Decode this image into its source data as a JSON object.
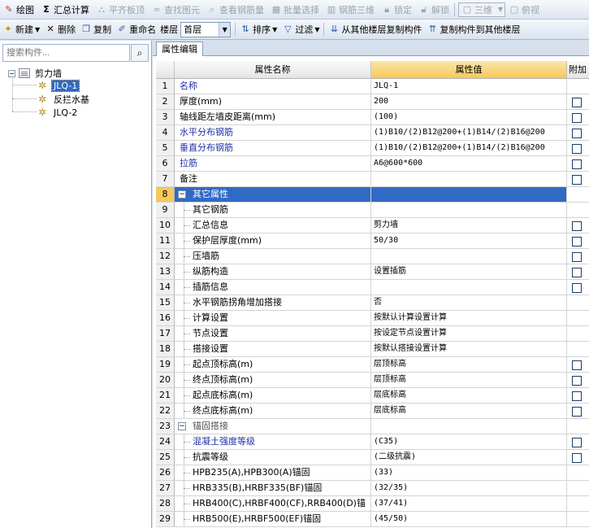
{
  "toolbar1": {
    "draw": "绘图",
    "sum_calc": "汇总计算",
    "flush_slab": "平齐板顶",
    "find_element": "查找图元",
    "view_rebar": "查看钢筋量",
    "batch_select": "批量选择",
    "rebar_3d": "钢筋三维",
    "lock": "锁定",
    "unlock": "解锁",
    "view_3d": "三维",
    "top_view": "俯视"
  },
  "toolbar2": {
    "new": "新建",
    "delete": "删除",
    "copy": "复制",
    "rename": "重命名",
    "floor_label": "楼层",
    "floor_value": "首层",
    "sort": "排序",
    "filter": "过滤",
    "copy_from_other": "从其他楼层复制构件",
    "copy_to_other": "复制构件到其他楼层"
  },
  "left": {
    "search_placeholder": "搜索构件...",
    "tree": {
      "root": "剪力墙",
      "children": [
        "JLQ-1",
        "反拦水基",
        "JLQ-2"
      ]
    }
  },
  "right": {
    "tab": "属性编辑",
    "headers": {
      "name": "属性名称",
      "value": "属性值",
      "add": "附加"
    },
    "rows": [
      {
        "n": "1",
        "name": "名称",
        "value": "JLQ-1",
        "blue": true,
        "chk": false
      },
      {
        "n": "2",
        "name": "厚度(mm)",
        "value": "200",
        "chk": true
      },
      {
        "n": "3",
        "name": "轴线距左墙皮距离(mm)",
        "value": "(100)",
        "chk": true
      },
      {
        "n": "4",
        "name": "水平分布钢筋",
        "value": "(1)B10/(2)B12@200+(1)B14/(2)B16@200",
        "blue": true,
        "chk": true
      },
      {
        "n": "5",
        "name": "垂直分布钢筋",
        "value": "(1)B10/(2)B12@200+(1)B14/(2)B16@200",
        "blue": true,
        "chk": true
      },
      {
        "n": "6",
        "name": "拉筋",
        "value": "A6@600*600",
        "blue": true,
        "chk": true
      },
      {
        "n": "7",
        "name": "备注",
        "value": "",
        "chk": true
      },
      {
        "n": "8",
        "name": "其它属性",
        "value": "",
        "group": true,
        "selected": true
      },
      {
        "n": "9",
        "name": "其它钢筋",
        "value": "",
        "child": true
      },
      {
        "n": "10",
        "name": "汇总信息",
        "value": "剪力墙",
        "child": true,
        "chk": true
      },
      {
        "n": "11",
        "name": "保护层厚度(mm)",
        "value": "50/30",
        "child": true,
        "chk": true
      },
      {
        "n": "12",
        "name": "压墙筋",
        "value": "",
        "child": true,
        "chk": true
      },
      {
        "n": "13",
        "name": "纵筋构造",
        "value": "设置插筋",
        "child": true,
        "chk": true
      },
      {
        "n": "14",
        "name": "插筋信息",
        "value": "",
        "child": true,
        "chk": true
      },
      {
        "n": "15",
        "name": "水平钢筋拐角增加搭接",
        "value": "否",
        "child": true
      },
      {
        "n": "16",
        "name": "计算设置",
        "value": "按默认计算设置计算",
        "child": true
      },
      {
        "n": "17",
        "name": "节点设置",
        "value": "按设定节点设置计算",
        "child": true
      },
      {
        "n": "18",
        "name": "搭接设置",
        "value": "按默认搭接设置计算",
        "child": true
      },
      {
        "n": "19",
        "name": "起点顶标高(m)",
        "value": "层顶标高",
        "child": true,
        "chk": true
      },
      {
        "n": "20",
        "name": "终点顶标高(m)",
        "value": "层顶标高",
        "child": true,
        "chk": true
      },
      {
        "n": "21",
        "name": "起点底标高(m)",
        "value": "层底标高",
        "child": true,
        "chk": true
      },
      {
        "n": "22",
        "name": "终点底标高(m)",
        "value": "层底标高",
        "child": true,
        "chk": true
      },
      {
        "n": "23",
        "name": "锚固搭接",
        "value": "",
        "group": true,
        "grey": true
      },
      {
        "n": "24",
        "name": "混凝土强度等级",
        "value": "(C35)",
        "child": true,
        "blue": true,
        "chk": true
      },
      {
        "n": "25",
        "name": "抗震等级",
        "value": "(二级抗震)",
        "child": true,
        "chk": true
      },
      {
        "n": "26",
        "name": "HPB235(A),HPB300(A)锚固",
        "value": "(33)",
        "child": true
      },
      {
        "n": "27",
        "name": "HRB335(B),HRBF335(BF)锚固",
        "value": "(32/35)",
        "child": true
      },
      {
        "n": "28",
        "name": "HRB400(C),HRBF400(CF),RRB400(D)锚",
        "value": "(37/41)",
        "child": true
      },
      {
        "n": "29",
        "name": "HRB500(E),HRBF500(EF)锚固",
        "value": "(45/50)",
        "child": true
      }
    ]
  }
}
